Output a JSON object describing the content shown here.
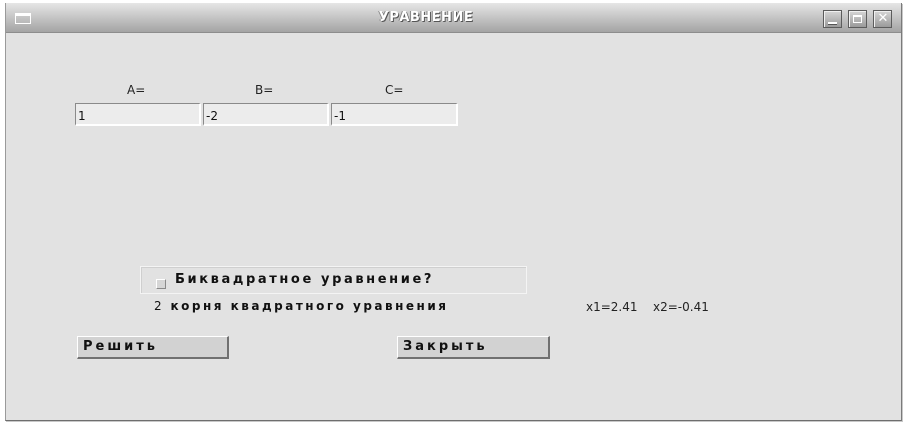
{
  "window": {
    "title": "УРАВНЕНИЕ"
  },
  "form": {
    "label_a": "A=",
    "label_b": "B=",
    "label_c": "C=",
    "value_a": "1",
    "value_b": "-2",
    "value_c": "-1"
  },
  "biquadratic": {
    "label": "Биквадратное уравнение?",
    "checked": false
  },
  "result": {
    "count": "2",
    "text": "корня квадратного уравнения",
    "x1": "x1=2.41",
    "x2": "x2=-0.41"
  },
  "buttons": {
    "solve": "Решить",
    "close": "Закрыть"
  }
}
